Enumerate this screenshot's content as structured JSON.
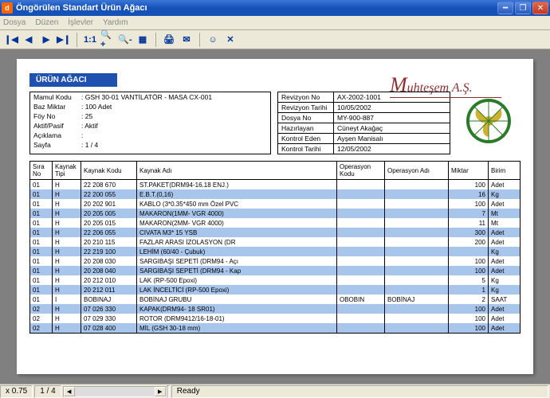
{
  "window": {
    "title": "Öngörülen Standart Ürün Ağacı",
    "app_icon_letter": "d"
  },
  "menu": {
    "dosya": "Dosya",
    "duzen": "Düzen",
    "islevler": "İşlevler",
    "yardim": "Yardım"
  },
  "toolbar": {
    "first": "❙◀",
    "prev": "◀",
    "next": "▶",
    "last": "▶❙",
    "fit": "1:1",
    "zoomin": "🔍+",
    "zoomout": "🔍-",
    "grid": "▦",
    "print": "🖨",
    "mail": "✉",
    "smile": "☺",
    "close": "✕"
  },
  "company": "uhteşem A.Ş.",
  "report_title": "ÜRÜN AĞACI",
  "header_left": {
    "mamul_kodu_lbl": "Mamul Kodu",
    "mamul_kodu": ": GSH 30-01  VANTİLATÖR - MASA CX-001",
    "baz_miktar_lbl": "Baz Miktar",
    "baz_miktar": ": 100 Adet",
    "foy_no_lbl": "Föy No",
    "foy_no": ": 25",
    "aktif_lbl": "Aktif/Pasif",
    "aktif": ": Aktif",
    "aciklama_lbl": "Açıklama",
    "aciklama": ":",
    "sayfa_lbl": "Sayfa",
    "sayfa": ": 1  /  4"
  },
  "header_mid": {
    "revno_lbl": "Revizyon No",
    "revno": "AX-2002-1001",
    "revtar_lbl": "Revizyon Tarihi",
    "revtar": "10/05/2002",
    "dosya_lbl": "Dosya No",
    "dosya": "MY-900-887",
    "hazir_lbl": "Hazırlayan",
    "hazir": "Cüneyt Akağaç",
    "kontrol_lbl": "Kontrol Eden",
    "kontrol": "Ayşen Manisalı",
    "ktarih_lbl": "Kontrol Tarihi",
    "ktarih": "12/05/2002"
  },
  "columns": {
    "sira": "Sıra No",
    "tipi": "Kaynak Tipi",
    "kodu": "Kaynak Kodu",
    "adi": "Kaynak Adı",
    "opkodu": "Operasyon Kodu",
    "opadi": "Operasyon Adı",
    "miktar": "Miktar",
    "birim": "Birim"
  },
  "rows": [
    {
      "sira": "01",
      "tipi": "H",
      "kodu": "22 208 670",
      "adi": "ST.PAKET(DRM94-16.18 ENJ.)",
      "opk": "",
      "opa": "",
      "mik": "100",
      "birim": "Adet"
    },
    {
      "sira": "01",
      "tipi": "H",
      "kodu": "22 200 055",
      "adi": "E.B.T.(0,16)",
      "opk": "",
      "opa": "",
      "mik": "16",
      "birim": "Kg"
    },
    {
      "sira": "01",
      "tipi": "H",
      "kodu": "20 202 901",
      "adi": "KABLO (3*0.35*450 mm Özel PVC",
      "opk": "",
      "opa": "",
      "mik": "100",
      "birim": "Adet"
    },
    {
      "sira": "01",
      "tipi": "H",
      "kodu": "20 205 005",
      "adi": "MAKARON(1MM- VGR 4000)",
      "opk": "",
      "opa": "",
      "mik": "7",
      "birim": "Mt"
    },
    {
      "sira": "01",
      "tipi": "H",
      "kodu": "20 205 015",
      "adi": "MAKARON(2MM- VGR 4000)",
      "opk": "",
      "opa": "",
      "mik": "11",
      "birim": "Mt"
    },
    {
      "sira": "01",
      "tipi": "H",
      "kodu": "22 206 055",
      "adi": "CIVATA M3* 15 YSB",
      "opk": "",
      "opa": "",
      "mik": "300",
      "birim": "Adet"
    },
    {
      "sira": "01",
      "tipi": "H",
      "kodu": "20 210 115",
      "adi": "FAZLAR ARASI İZOLASYON (DR",
      "opk": "",
      "opa": "",
      "mik": "200",
      "birim": "Adet"
    },
    {
      "sira": "01",
      "tipi": "H",
      "kodu": "22 219 100",
      "adi": "LEHİM (60/40 - Çubuk)",
      "opk": "",
      "opa": "",
      "mik": "",
      "birim": "Kg"
    },
    {
      "sira": "01",
      "tipi": "H",
      "kodu": "20 208 030",
      "adi": "SARGIBAŞI SEPETİ (DRM94 - Açı",
      "opk": "",
      "opa": "",
      "mik": "100",
      "birim": "Adet"
    },
    {
      "sira": "01",
      "tipi": "H",
      "kodu": "20 208 040",
      "adi": "SARGIBAŞI SEPETİ (DRM94 - Kap",
      "opk": "",
      "opa": "",
      "mik": "100",
      "birim": "Adet"
    },
    {
      "sira": "01",
      "tipi": "H",
      "kodu": "20 212 010",
      "adi": "LAK (RP-500 Epoxi)",
      "opk": "",
      "opa": "",
      "mik": "5",
      "birim": "Kg"
    },
    {
      "sira": "01",
      "tipi": "H",
      "kodu": "20 212 011",
      "adi": "LAK İNCELTİCİ (RP-500 Epoxi)",
      "opk": "",
      "opa": "",
      "mik": "1",
      "birim": "Kg"
    },
    {
      "sira": "01",
      "tipi": "I",
      "kodu": "BOBINAJ",
      "adi": "BOBİNAJ GRUBU",
      "opk": "OBOBIN",
      "opa": "BOBİNAJ",
      "mik": "2",
      "birim": "SAAT"
    },
    {
      "sira": "02",
      "tipi": "H",
      "kodu": "07 026 330",
      "adi": "KAPAK(DRM94- 18 SR01)",
      "opk": "",
      "opa": "",
      "mik": "100",
      "birim": "Adet"
    },
    {
      "sira": "02",
      "tipi": "H",
      "kodu": "07 029 330",
      "adi": "ROTOR (DRM9412/16-18-01)",
      "opk": "",
      "opa": "",
      "mik": "100",
      "birim": "Adet"
    },
    {
      "sira": "02",
      "tipi": "H",
      "kodu": "07 028 400",
      "adi": "MİL (GSH 30-18 mm)",
      "opk": "",
      "opa": "",
      "mik": "100",
      "birim": "Adet"
    }
  ],
  "status": {
    "zoom": "x 0.75",
    "page": "1 / 4",
    "ready": "Ready"
  }
}
